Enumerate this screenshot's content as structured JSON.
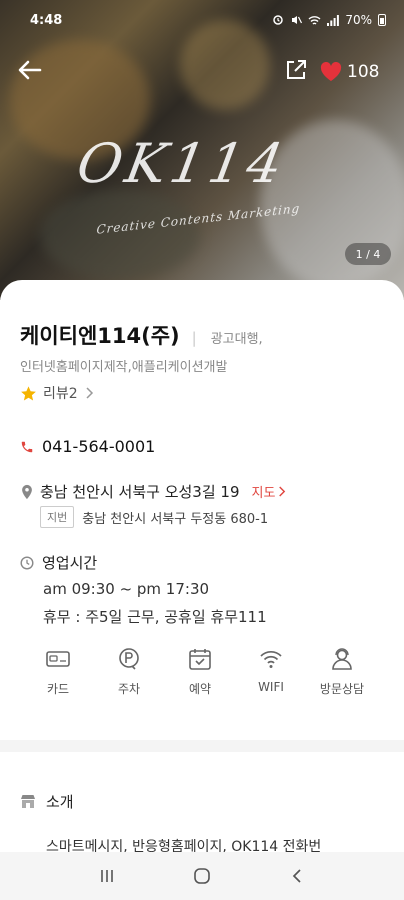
{
  "status": {
    "time": "4:48",
    "battery": "70%"
  },
  "hero": {
    "logo": "OK114",
    "tagline": "Creative Contents Marketing",
    "pager": "1 / 4",
    "likes": "108"
  },
  "business": {
    "name": "케이티엔114(주)",
    "category_line1": "광고대행,",
    "category_line2": "인터넷홈페이지제작,애플리케이션개발",
    "review_label": "리뷰2",
    "phone": "041-564-0001",
    "address": "충남 천안시 서북구 오성3길 19",
    "map_link": "지도",
    "jibun_badge": "지번",
    "jibun_address": "충남 천안시 서북구 두정동 680-1",
    "hours_title": "영업시간",
    "hours": "am 09:30 ~ pm 17:30",
    "holiday": "휴무 : 주5일 근무, 공휴일 휴무111"
  },
  "amenities": [
    {
      "label": "카드",
      "icon": "card-icon"
    },
    {
      "label": "주차",
      "icon": "parking-icon"
    },
    {
      "label": "예약",
      "icon": "reservation-icon"
    },
    {
      "label": "WIFI",
      "icon": "wifi-icon"
    },
    {
      "label": "방문상담",
      "icon": "consult-icon"
    }
  ],
  "intro": {
    "title": "소개",
    "text": "스마트메시지, 반응형홈페이지, OK114 전화번"
  },
  "colors": {
    "accent_red": "#e0463f",
    "star_yellow": "#f5b400",
    "heart_red": "#e5323b"
  }
}
